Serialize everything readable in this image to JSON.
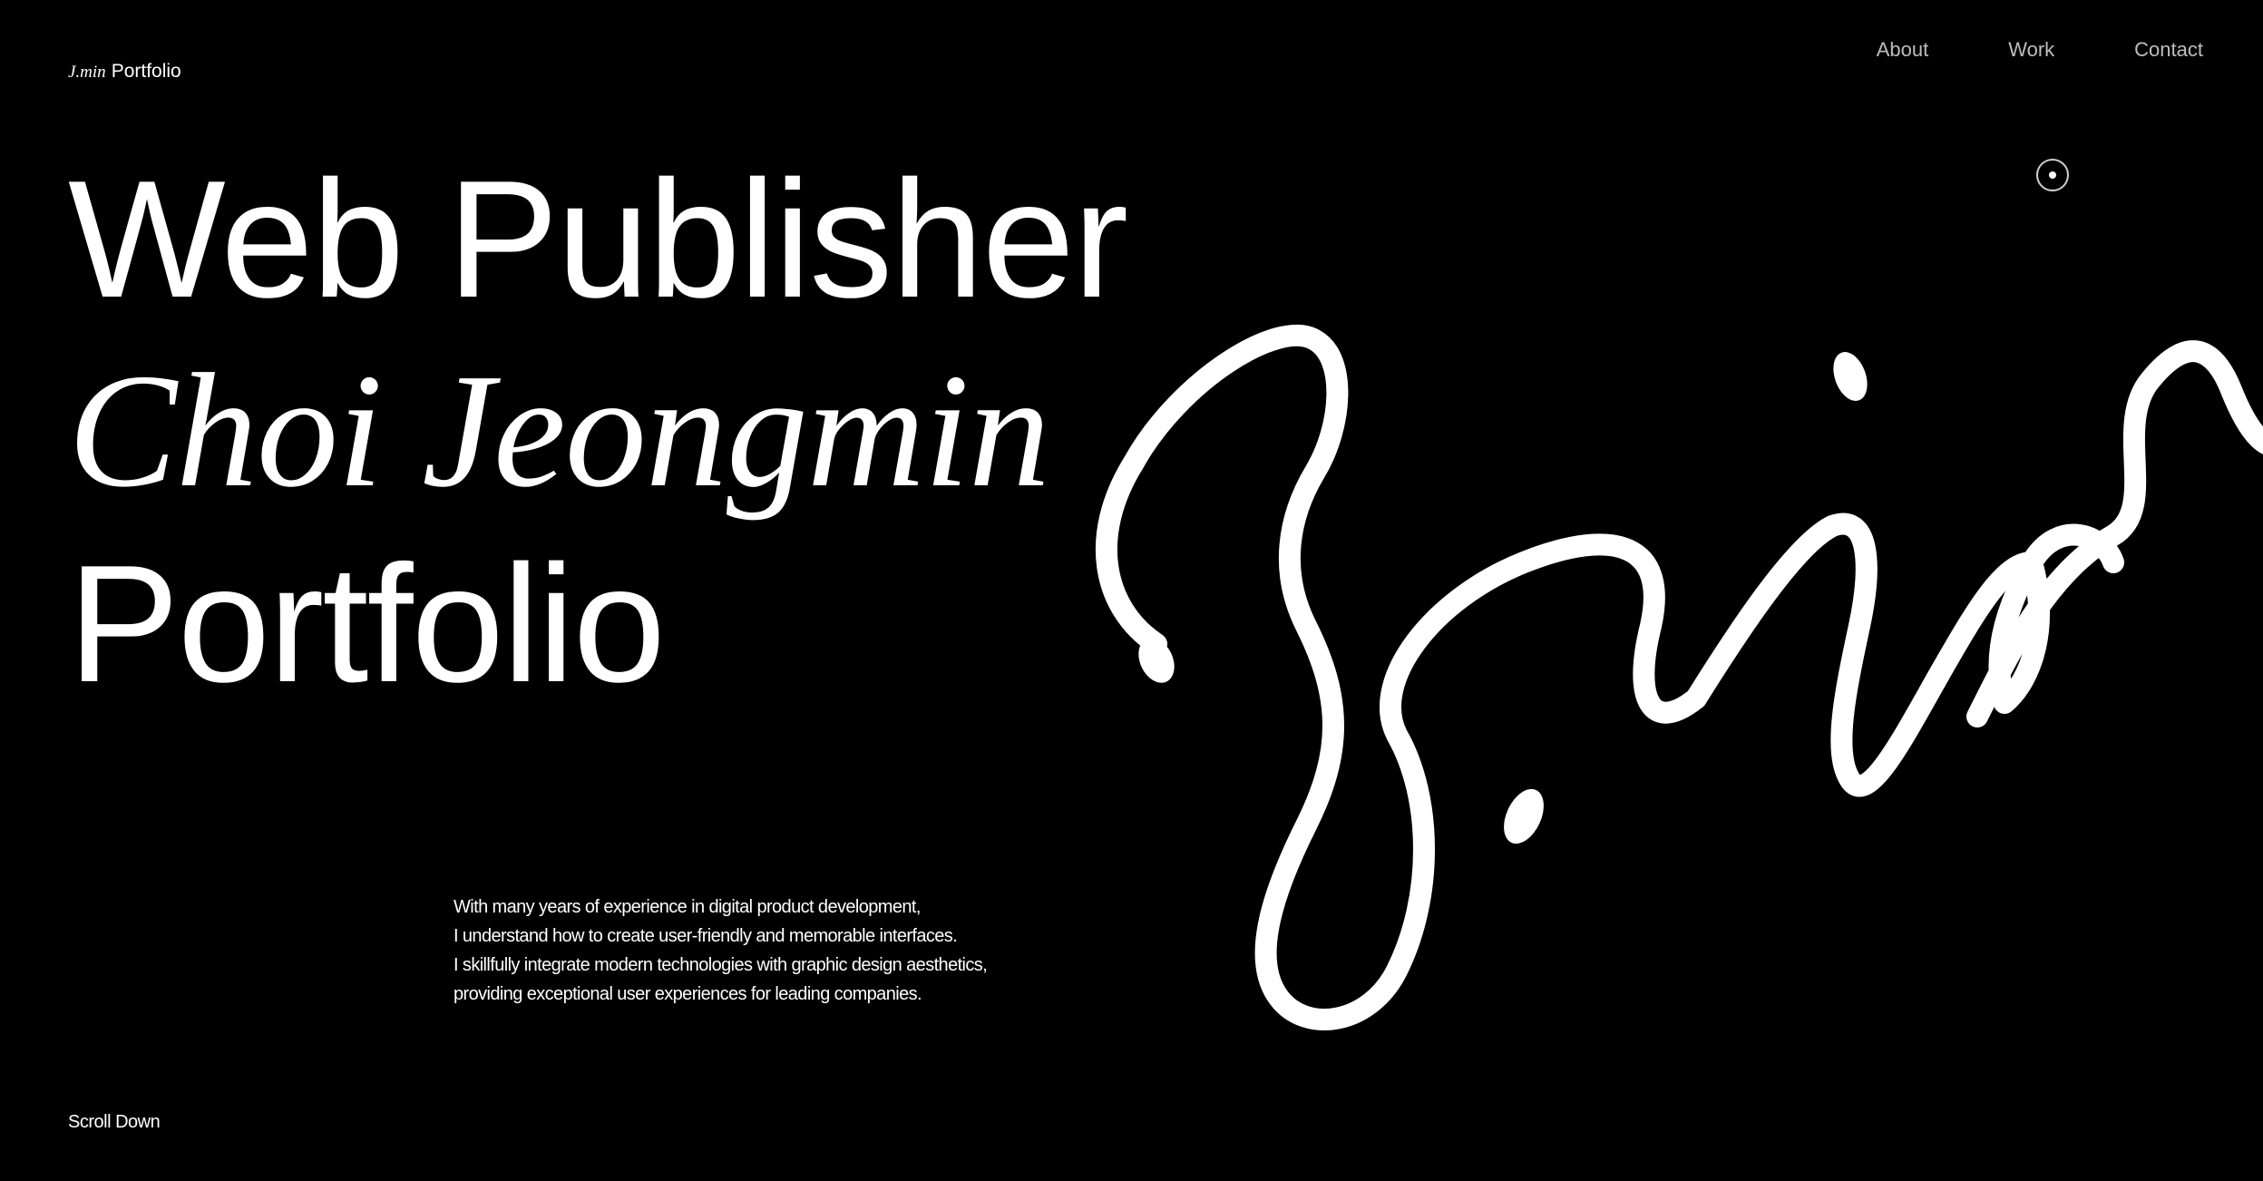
{
  "header": {
    "logo_mark": "J.min",
    "logo_text": "Portfolio"
  },
  "nav": {
    "items": [
      {
        "label": "About"
      },
      {
        "label": "Work"
      },
      {
        "label": "Contact"
      }
    ]
  },
  "hero": {
    "line1": "Web Publisher",
    "line2": "Choi Jeongmin",
    "line3": "Portfolio"
  },
  "description": {
    "lines": [
      "With many years of experience in digital product development,",
      "I understand how to create user-friendly and memorable interfaces.",
      "I skillfully integrate modern technologies with graphic design aesthetics,",
      "providing exceptional user experiences for leading companies."
    ]
  },
  "footer": {
    "scroll_label": "Scroll Down"
  },
  "colors": {
    "background": "#000000",
    "text": "#ffffff",
    "nav_text": "#bdbdbd"
  }
}
